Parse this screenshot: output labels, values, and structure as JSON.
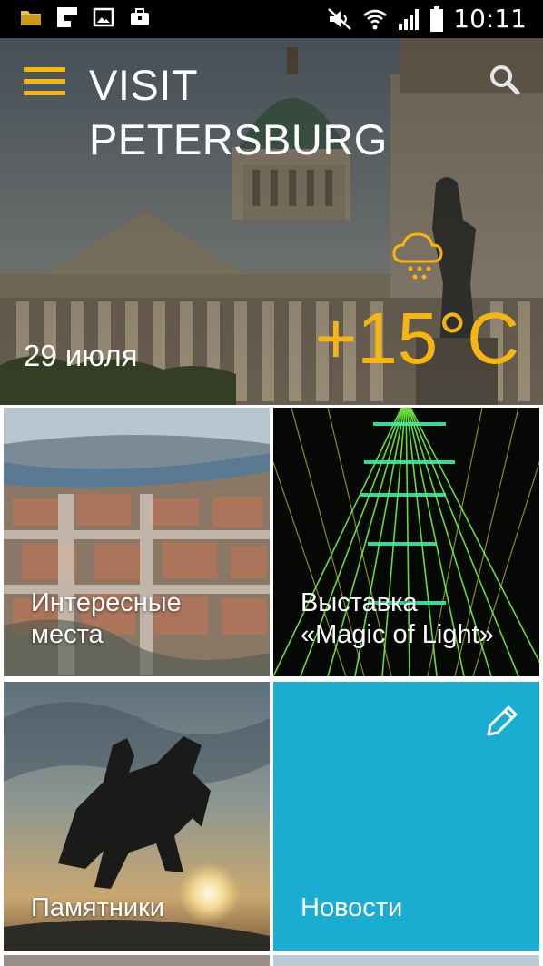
{
  "status_bar": {
    "time": "10:11",
    "left_icons": [
      "folder-icon",
      "flipboard-icon",
      "image-icon",
      "briefcase-icon"
    ],
    "right_icons": [
      "mute-icon",
      "wifi-icon",
      "signal-icon",
      "battery-icon"
    ]
  },
  "header": {
    "title_line1": "VISIT",
    "title_line2": "PETERSBURG",
    "menu_icon": "hamburger-menu-icon",
    "search_icon": "search-icon"
  },
  "weather": {
    "date": "29 июля",
    "temperature": "+15°C",
    "icon": "rain-cloud-icon"
  },
  "tiles": [
    {
      "label_line1": "Интересные",
      "label_line2": "места"
    },
    {
      "label_line1": "Выставка",
      "label_line2": "«Magic of Light»"
    },
    {
      "label_line1": "Памятники",
      "label_line2": ""
    },
    {
      "label_line1": "Новости",
      "label_line2": "",
      "icon": "pencil-icon"
    }
  ],
  "colors": {
    "accent": "#f4b515",
    "news_tile": "#1aadd2",
    "status_bar": "#000000"
  }
}
